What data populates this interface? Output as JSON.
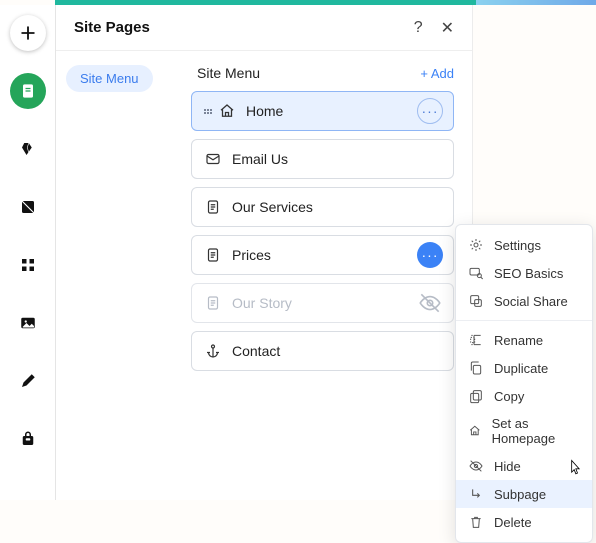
{
  "left_rail": {
    "items": [
      {
        "name": "add",
        "interactable": true
      },
      {
        "name": "pages",
        "interactable": true,
        "active": true
      },
      {
        "name": "design",
        "interactable": true
      },
      {
        "name": "section",
        "interactable": true
      },
      {
        "name": "apps",
        "interactable": true
      },
      {
        "name": "media",
        "interactable": true
      },
      {
        "name": "blog",
        "interactable": true
      },
      {
        "name": "store",
        "interactable": true
      }
    ]
  },
  "panel": {
    "title": "Site Pages",
    "help_label": "?",
    "close_label": "✕",
    "side_chip": "Site Menu",
    "section_title": "Site Menu",
    "add_label": "Add"
  },
  "pages": [
    {
      "id": "home",
      "label": "Home",
      "icon": "home",
      "state": "selected",
      "action": "dots-outline",
      "drag": true
    },
    {
      "id": "email",
      "label": "Email Us",
      "icon": "mail",
      "state": "normal"
    },
    {
      "id": "services",
      "label": "Our Services",
      "icon": "doc",
      "state": "normal"
    },
    {
      "id": "prices",
      "label": "Prices",
      "icon": "doc",
      "state": "normal",
      "action": "dots-solid"
    },
    {
      "id": "story",
      "label": "Our Story",
      "icon": "doc",
      "state": "hidden",
      "action": "eye-off"
    },
    {
      "id": "contact",
      "label": "Contact",
      "icon": "anchor",
      "state": "normal"
    }
  ],
  "context_menu": {
    "groups": [
      [
        {
          "id": "settings",
          "label": "Settings",
          "icon": "gear"
        },
        {
          "id": "seo",
          "label": "SEO Basics",
          "icon": "seo"
        },
        {
          "id": "social",
          "label": "Social Share",
          "icon": "share"
        }
      ],
      [
        {
          "id": "rename",
          "label": "Rename",
          "icon": "rename"
        },
        {
          "id": "duplicate",
          "label": "Duplicate",
          "icon": "duplicate"
        },
        {
          "id": "copy",
          "label": "Copy",
          "icon": "copy"
        },
        {
          "id": "homepage",
          "label": "Set as Homepage",
          "icon": "home"
        },
        {
          "id": "hide",
          "label": "Hide",
          "icon": "eye-off"
        },
        {
          "id": "subpage",
          "label": "Subpage",
          "icon": "subpage",
          "hover": true
        },
        {
          "id": "delete",
          "label": "Delete",
          "icon": "trash"
        }
      ]
    ]
  }
}
